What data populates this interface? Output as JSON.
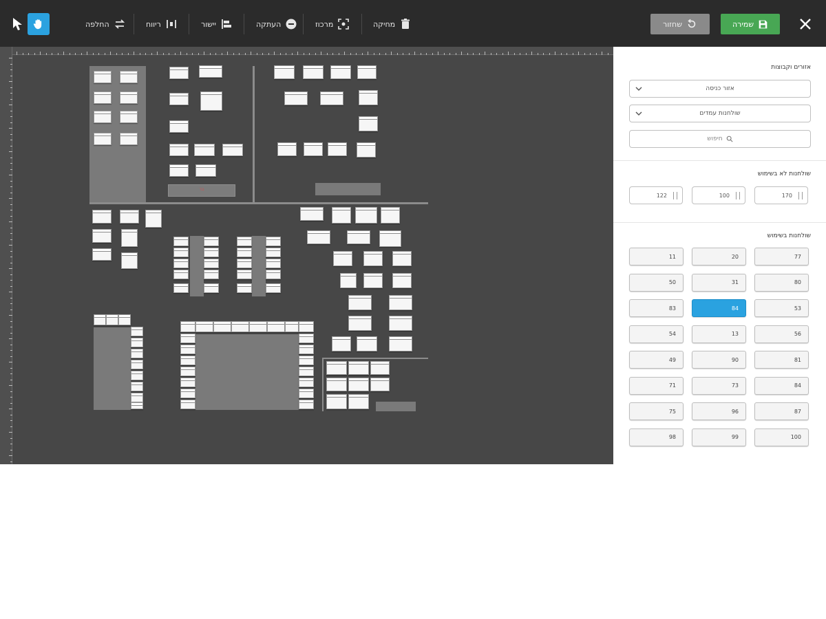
{
  "toolbar": {
    "exchange_label": "החלפה",
    "space_label": "ריווח",
    "align_label": "יישור",
    "copy_label": "העתקה",
    "center_label": "מרכוז",
    "delete_label": "מחיקה",
    "undo_label": "שחזור",
    "save_label": "שמירה"
  },
  "colors": {
    "toolbar_bg": "#2b2b2b",
    "canvas_bg": "#474747",
    "accent_blue": "#2ba2e0",
    "save_green": "#48a754",
    "undo_gray": "#8a8a8a"
  },
  "canvas": {
    "bar_label": "בר"
  },
  "sidebar": {
    "section1": {
      "title": "אזורים וקבוצות",
      "area_select": "אזור כניסה",
      "group_select": "שולחנות עמדים",
      "search_placeholder": "חיפוש"
    },
    "section2": {
      "title": "שולחנות לא בשימוש",
      "inputs": [
        "170",
        "100",
        "122"
      ]
    },
    "section3": {
      "title": "שולחנות בשימוש",
      "selected": "84",
      "buttons": [
        [
          "77",
          "20",
          "11"
        ],
        [
          "80",
          "31",
          "50"
        ],
        [
          "53",
          "84",
          "83"
        ],
        [
          "56",
          "13",
          "54"
        ],
        [
          "81",
          "90",
          "49"
        ],
        [
          "84",
          "73",
          "71"
        ],
        [
          "87",
          "96",
          "75"
        ],
        [
          "100",
          "99",
          "98"
        ]
      ]
    }
  }
}
